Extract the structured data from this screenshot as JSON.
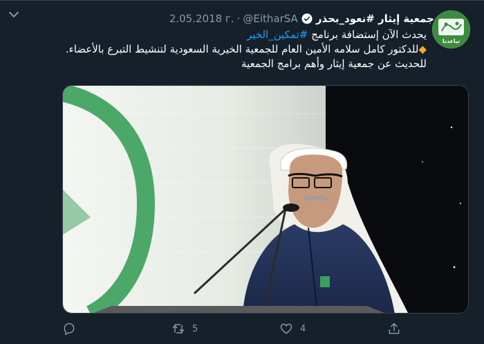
{
  "tweet": {
    "display_name": "جمعية إيثار #نعود_بحذر",
    "handle": "@EitharSA",
    "separator": "·",
    "timestamp": "2.05.2018 г.",
    "line1_text": "يحدث الآن  إستضافة برنامج ",
    "line1_hashtag": "#تمكين_الخير",
    "line2_marker": "◆",
    "line2_text": "للدكتور كامل سلامه الأمين العام للجمعية الخيرية السعودية لتنشيط التبرع بالأعضاء. للحديث عن جمعية إيثار وأهم برامج الجمعية"
  },
  "avatar": {
    "logo_text": "تباعدنا",
    "brand_color": "#3b8c3c"
  },
  "actions": {
    "retweet_count": "5",
    "like_count": "4"
  },
  "icons": [
    "chevron-down-icon",
    "verified-badge-icon",
    "reply-icon",
    "retweet-icon",
    "like-icon",
    "share-icon"
  ],
  "colors": {
    "background": "#15202b",
    "accent": "#1da1f2",
    "secondary_text": "#8899a6",
    "verified": "#ffffff"
  }
}
